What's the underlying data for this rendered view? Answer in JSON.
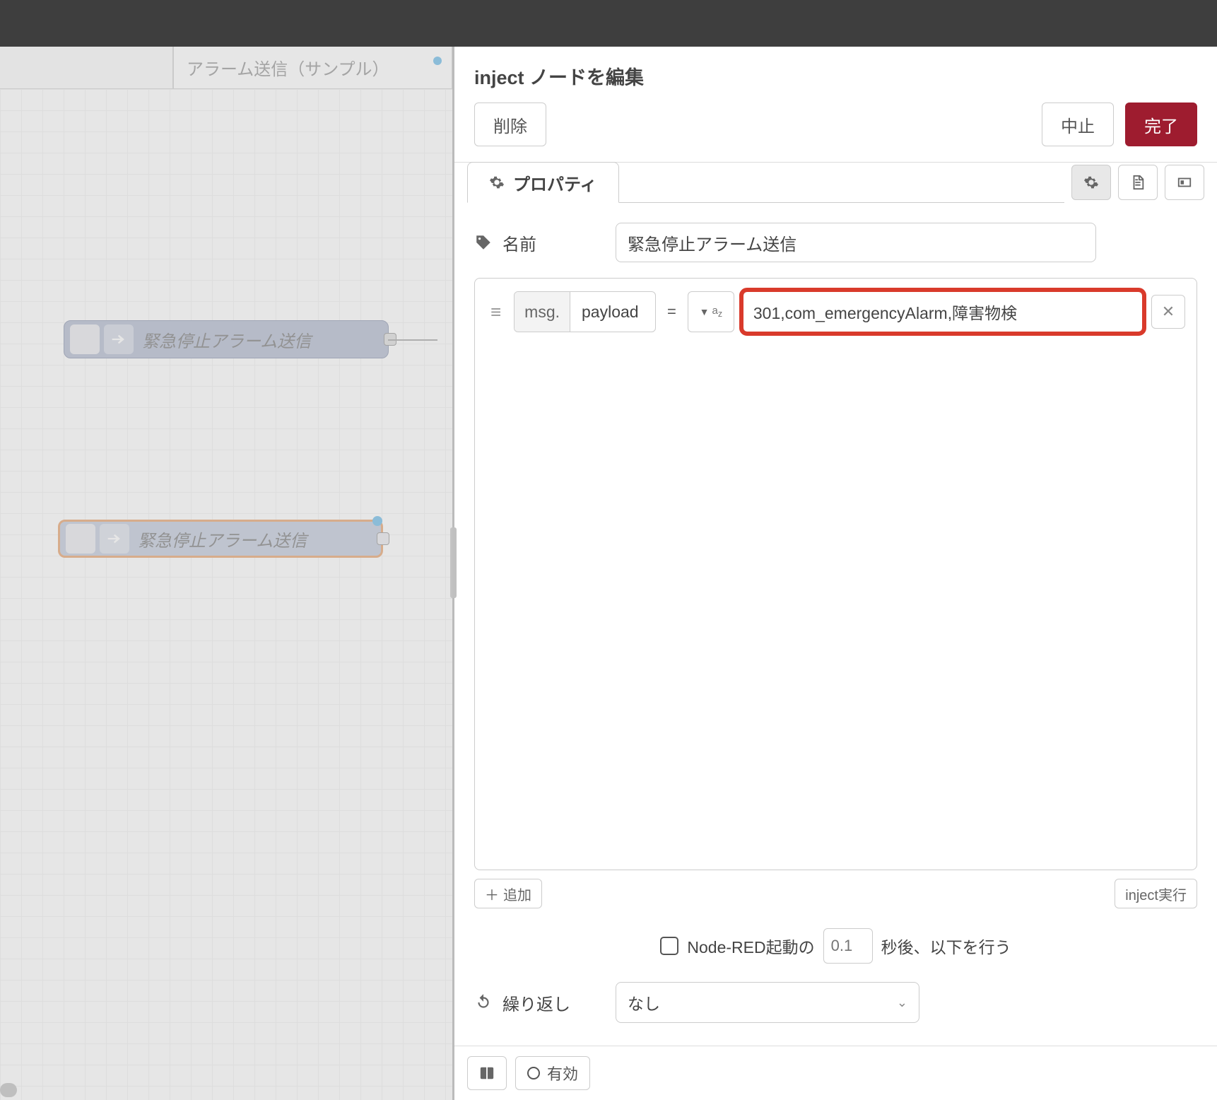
{
  "tab": {
    "name": "アラーム送信（サンプル）"
  },
  "nodes": {
    "n1_label": "緊急停止アラーム送信",
    "n2_label": "緊急停止アラーム送信"
  },
  "panel": {
    "title": "inject ノードを編集",
    "delete": "削除",
    "cancel": "中止",
    "done": "完了",
    "tab_props": "プロパティ",
    "name_label": "名前",
    "name_value": "緊急停止アラーム送信",
    "rule": {
      "msg_prefix": "msg.",
      "msg_field": "payload",
      "eq": "=",
      "value": "301,com_emergencyAlarm,障害物検"
    },
    "add": "追加",
    "inject_now": "inject実行",
    "once_pre": "Node-RED起動の",
    "once_delay": "0.1",
    "once_post": "秒後、以下を行う",
    "repeat_label": "繰り返し",
    "repeat_value": "なし",
    "enabled": "有効"
  }
}
